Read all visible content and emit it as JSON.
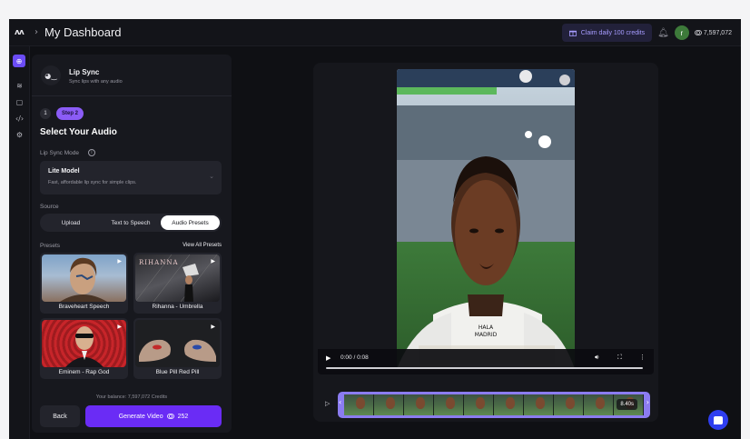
{
  "header": {
    "logo_text": "ᴧᴧ",
    "chevron": "›",
    "title": "My Dashboard",
    "claim_label": "Claim daily 100 credits",
    "claim_icon": "gift-icon",
    "avatar_initial": "r",
    "credits": "7,597,072",
    "credits_icon": "coin-icon"
  },
  "sidebar": {
    "items": [
      "plus-circle-icon",
      "layers-icon",
      "box-icon",
      "code-icon",
      "settings-icon"
    ]
  },
  "panel": {
    "tool_name": "Lip Sync",
    "tool_desc": "Sync lips with any audio",
    "step_number": "1",
    "step_pill": "Step 2",
    "step_title": "Select Your Audio",
    "mode_label": "Lip Sync Mode",
    "mode_name": "Lite Model",
    "mode_desc": "Fast, affordable lip sync for simple clips.",
    "source_label": "Source",
    "tabs": [
      {
        "label": "Upload",
        "active": false
      },
      {
        "label": "Text to Speech",
        "active": false
      },
      {
        "label": "Audio Presets",
        "active": true
      }
    ],
    "presets_label": "Presets",
    "view_all": "View All Presets",
    "presets": [
      {
        "label": "Braveheart Speech"
      },
      {
        "label": "Rihanna - Umbrella",
        "thumb_text": "RIHANNA"
      },
      {
        "label": "Eminem - Rap God"
      },
      {
        "label": "Blue Pill Red Pill"
      }
    ],
    "balance": "Your balance: 7,597,072 Credits",
    "back_label": "Back",
    "generate_label": "Generate Video",
    "generate_cost": "252"
  },
  "video": {
    "time": "0:00 / 0:08",
    "progress": 0,
    "duration_badge": "8.40s",
    "jersey_text": "HALA\nMADRID"
  },
  "colors": {
    "accent": "#6a2cf5",
    "pill": "#8b5cf6",
    "background": "#0f1014"
  }
}
